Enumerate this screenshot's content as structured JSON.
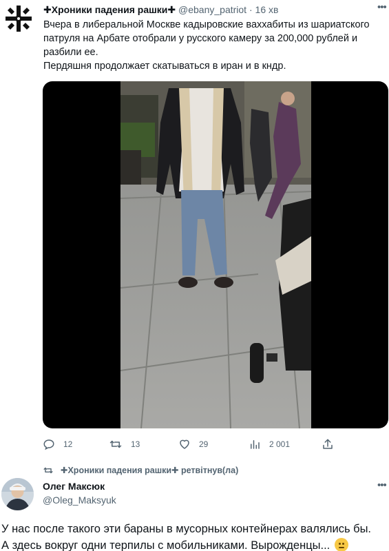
{
  "tweet": {
    "author_name": "✚Хроники падения рашки✚",
    "handle": "@ebany_patriot",
    "dot": "·",
    "time": "16 хв",
    "text_lines": [
      "Вчера в либеральной Москве кадыровские ваххабиты из шариатского патруля на Арбате отобрали у русского камеру за 200,000 рублей и разбили ее.",
      "Пердяшня продолжает скатываться в иран и в кндр."
    ],
    "more_icon": "more-icon",
    "media": {
      "kind": "video",
      "icon": "video-thumbnail"
    },
    "actions": {
      "reply_count": "12",
      "retweet_count": "13",
      "like_count": "29",
      "views_count": "2 001"
    }
  },
  "retweet_label": "✚Хроники падения рашки✚ ретвітнув(ла)",
  "reply": {
    "author_name": "Олег Максюк",
    "handle": "@Oleg_Maksyuk",
    "text_lines": [
      "У нас после такого эти бараны в мусорных контейнерах валялись бы.",
      "А здесь вокруг одни терпилы с мобильниками. Вырожденцы..."
    ]
  }
}
